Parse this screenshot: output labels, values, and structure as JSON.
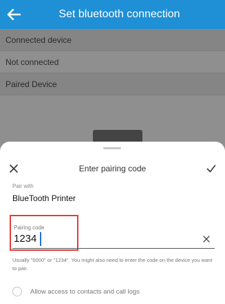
{
  "app_bar": {
    "title": "Set bluetooth connection",
    "back_icon": "back-arrow-icon"
  },
  "sections": {
    "connected_header": "Connected device",
    "connected_status": "Not connected",
    "paired_header": "Paired Device"
  },
  "sheet": {
    "title": "Enter pairing code",
    "close_icon": "close-icon",
    "confirm_icon": "checkmark-icon",
    "pair_with_label": "Pair with",
    "device_name": "BlueTooth Printer",
    "code_label": "Pairing code",
    "code_value": "1234",
    "clear_icon": "clear-icon",
    "hint": "Usually \"0000\" or \"1234\". You might also need to enter the code on the device you want to pair.",
    "contacts_label": "Allow access to contacts and call logs"
  },
  "colors": {
    "accent": "#1f8fd6",
    "highlight": "#e53b3b",
    "caret": "#1f6fe0"
  }
}
